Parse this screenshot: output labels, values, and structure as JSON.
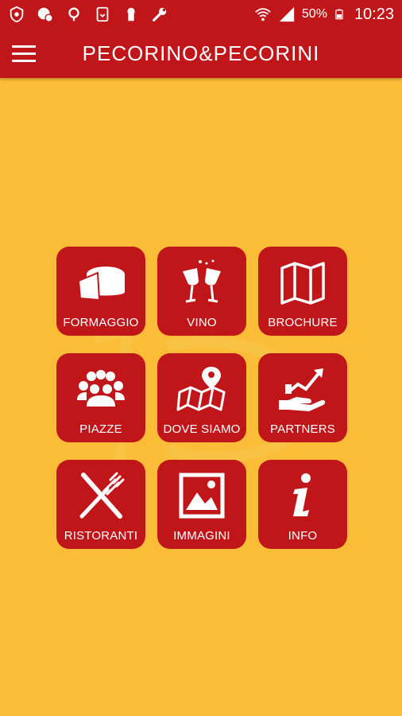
{
  "status_bar": {
    "battery": "50%",
    "time": "10:23"
  },
  "app_bar": {
    "title": "PECORINO&PECORINI"
  },
  "tiles": [
    {
      "label": "FORMAGGIO",
      "icon": "cheese-icon"
    },
    {
      "label": "VINO",
      "icon": "wine-glasses-icon"
    },
    {
      "label": "BROCHURE",
      "icon": "map-icon"
    },
    {
      "label": "PIAZZE",
      "icon": "crowd-icon"
    },
    {
      "label": "DOVE SIAMO",
      "icon": "location-map-icon"
    },
    {
      "label": "PARTNERS",
      "icon": "handshake-growth-icon"
    },
    {
      "label": "RISTORANTI",
      "icon": "fork-knife-icon"
    },
    {
      "label": "IMMAGINI",
      "icon": "image-icon"
    },
    {
      "label": "INFO",
      "icon": "info-icon"
    }
  ],
  "colors": {
    "primary": "#c0161a",
    "background": "#fbbd38"
  }
}
